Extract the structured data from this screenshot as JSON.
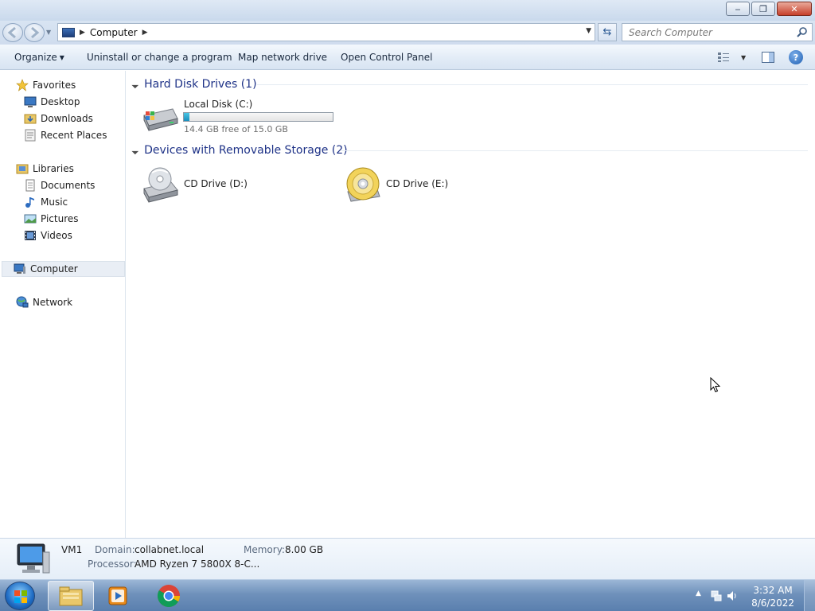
{
  "window": {
    "caption_buttons": {
      "minimize": "‒",
      "maximize": "❐",
      "close": "✕"
    }
  },
  "address": {
    "crumb": "Computer"
  },
  "search": {
    "placeholder": "Search Computer"
  },
  "toolbar": {
    "organize": "Organize",
    "uninstall": "Uninstall or change a program",
    "map_drive": "Map network drive",
    "control_panel": "Open Control Panel",
    "help": "?"
  },
  "sidebar": {
    "favorites": {
      "label": "Favorites",
      "items": [
        {
          "label": "Desktop"
        },
        {
          "label": "Downloads"
        },
        {
          "label": "Recent Places"
        }
      ]
    },
    "libraries": {
      "label": "Libraries",
      "items": [
        {
          "label": "Documents"
        },
        {
          "label": "Music"
        },
        {
          "label": "Pictures"
        },
        {
          "label": "Videos"
        }
      ]
    },
    "computer": {
      "label": "Computer"
    },
    "network": {
      "label": "Network"
    }
  },
  "content": {
    "hard_disks": {
      "title": "Hard Disk Drives (1)",
      "drives": [
        {
          "label": "Local Disk (C:)",
          "free_text": "14.4 GB free of 15.0 GB",
          "used_fraction": 0.04
        }
      ]
    },
    "removable": {
      "title": "Devices with Removable Storage (2)",
      "drives": [
        {
          "label": "CD Drive (D:)"
        },
        {
          "label": "CD Drive (E:)"
        }
      ]
    }
  },
  "details": {
    "name": "VM1",
    "domain_key": "Domain:",
    "domain_val": "collabnet.local",
    "memory_key": "Memory:",
    "memory_val": "8.00 GB",
    "processor_key": "Processor:",
    "processor_val": "AMD Ryzen 7 5800X 8-C..."
  },
  "taskbar": {
    "clock_time": "3:32 AM",
    "clock_date": "8/6/2022",
    "apps": [
      "windows-explorer",
      "windows-media-player",
      "google-chrome"
    ]
  }
}
